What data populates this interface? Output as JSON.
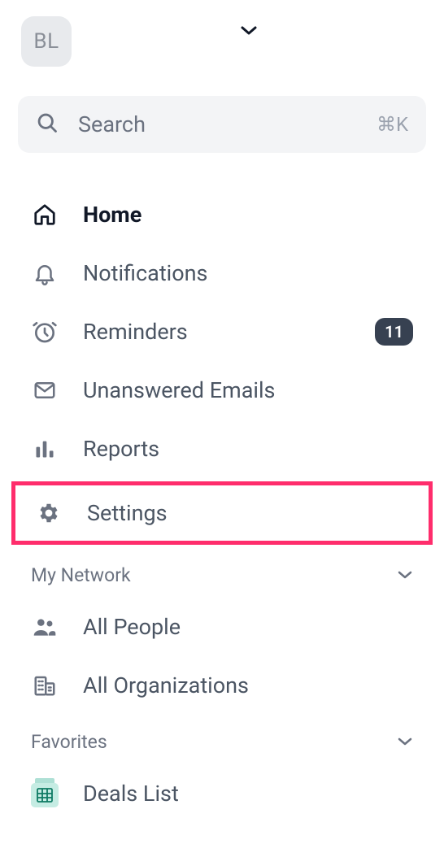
{
  "header": {
    "avatar_initials": "BL"
  },
  "search": {
    "placeholder": "Search",
    "shortcut": "⌘K"
  },
  "nav": {
    "home": "Home",
    "notifications": "Notifications",
    "reminders": "Reminders",
    "reminders_badge": "11",
    "unanswered": "Unanswered Emails",
    "reports": "Reports",
    "settings": "Settings"
  },
  "sections": {
    "network": {
      "title": "My Network",
      "people": "All People",
      "orgs": "All Organizations"
    },
    "favorites": {
      "title": "Favorites",
      "deals": "Deals List"
    }
  }
}
